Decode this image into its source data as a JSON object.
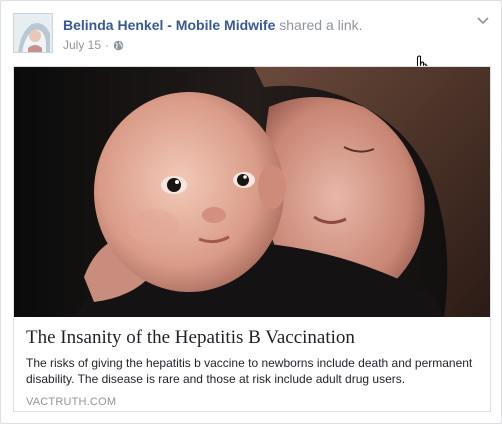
{
  "post": {
    "author": "Belinda Henkel - Mobile Midwife",
    "action": "shared a link.",
    "date": "July 15",
    "separator": "·",
    "privacy_icon": "globe-icon",
    "menu_icon": "chevron-down-icon"
  },
  "link": {
    "title": "The Insanity of the Hepatitis B Vaccination",
    "description": "The risks of giving the hepatitis b vaccine to newborns include death and permanent disability. The disease is rare and those at risk include adult drug users.",
    "domain": "VACTRUTH.COM",
    "image_icon": "mother-and-baby-photo"
  },
  "colors": {
    "author_link": "#365899",
    "secondary_text": "#90949c",
    "body_text": "#1d2129",
    "border": "#dddfe2"
  }
}
